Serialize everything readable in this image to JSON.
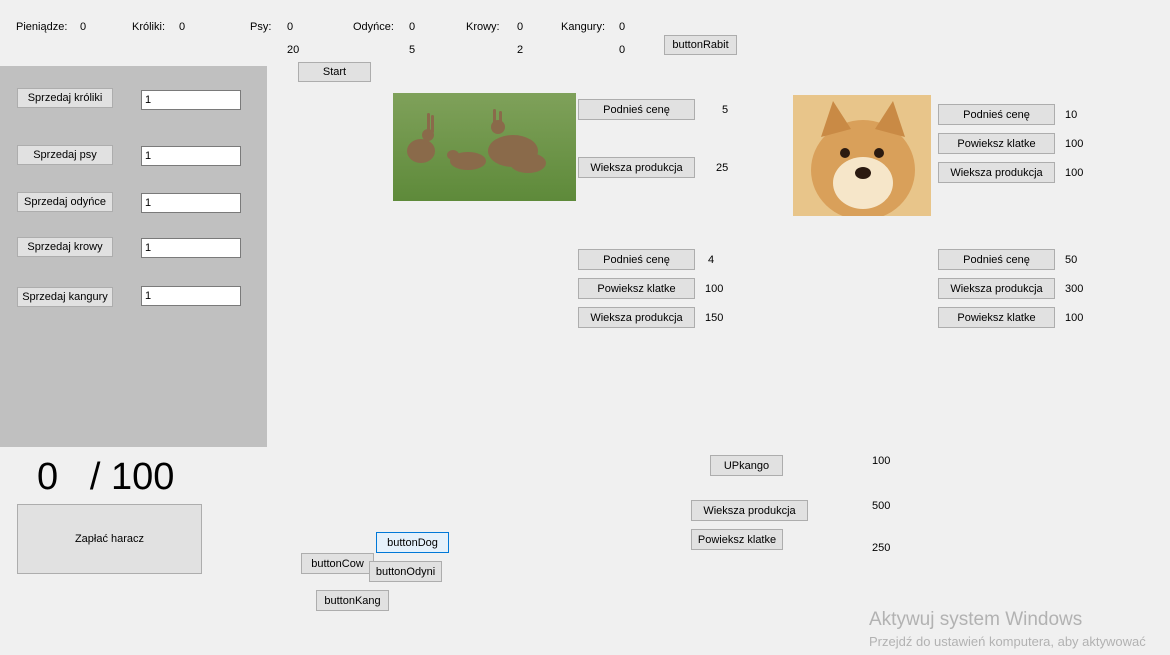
{
  "stats": {
    "money_label": "Pieniądze:",
    "money_value": "0",
    "rabbits_label": "Króliki:",
    "rabbits_value": "0",
    "dogs_label": "Psy:",
    "dogs_value": "0",
    "dogs_sub": "20",
    "boars_label": "Odyńce:",
    "boars_value": "0",
    "boars_sub": "5",
    "cows_label": "Krowy:",
    "cows_value": "0",
    "cows_sub": "2",
    "kangaroos_label": "Kangury:",
    "kangaroos_value": "0",
    "kangaroos_sub": "0"
  },
  "top": {
    "start": "Start",
    "button_rabit": "buttonRabit"
  },
  "sell": {
    "rabbits": {
      "label": "Sprzedaj króliki",
      "value": "1"
    },
    "dogs": {
      "label": "Sprzedaj psy",
      "value": "1"
    },
    "boars": {
      "label": "Sprzedaj odyńce",
      "value": "1"
    },
    "cows": {
      "label": "Sprzedaj krowy",
      "value": "1"
    },
    "kangaroos": {
      "label": "Sprzedaj kangury",
      "value": "1"
    }
  },
  "rabbit_panel": {
    "raise_price": "Podnieś cenę",
    "raise_price_value": "5",
    "more_production": "Wieksza produkcja",
    "more_production_value": "25"
  },
  "dog_panel": {
    "raise_price": "Podnieś cenę",
    "raise_price_value": "10",
    "enlarge_cage": "Powieksz klatke",
    "enlarge_cage_value": "100",
    "more_production": "Wieksza produkcja",
    "more_production_value": "100"
  },
  "boar_panel": {
    "raise_price": "Podnieś cenę",
    "raise_price_value": "4",
    "enlarge_cage": "Powieksz klatke",
    "enlarge_cage_value": "100",
    "more_production": "Wieksza produkcja",
    "more_production_value": "150"
  },
  "cow_panel": {
    "raise_price": "Podnieś cenę",
    "raise_price_value": "50",
    "more_production": "Wieksza produkcja",
    "more_production_value": "300",
    "enlarge_cage": "Powieksz klatke",
    "enlarge_cage_value": "100"
  },
  "kangaroo_panel": {
    "up_kango": "UPkango",
    "up_kango_value": "100",
    "more_production": "Wieksza produkcja",
    "more_production_value": "500",
    "enlarge_cage": "Powieksz klatke",
    "enlarge_cage_value": "250"
  },
  "tribute": {
    "current": "0",
    "total": "/ 100",
    "pay": "Zapłać haracz"
  },
  "debug_buttons": {
    "dog": "buttonDog",
    "cow": "buttonCow",
    "boar": "buttonOdyni",
    "kangaroo": "buttonKang"
  },
  "watermark": {
    "title": "Aktywuj system Windows",
    "subtitle": "Przejdź do ustawień komputera, aby aktywować"
  }
}
